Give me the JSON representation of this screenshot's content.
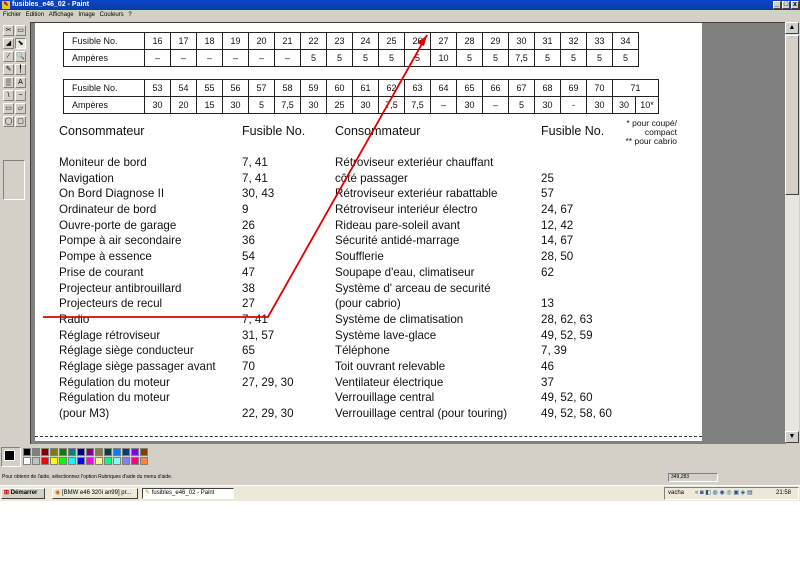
{
  "window": {
    "title": "fusibles_e46_02 - Paint",
    "buttons": [
      "_",
      "□",
      "x"
    ]
  },
  "menu": [
    "Fichier",
    "Edition",
    "Affichage",
    "Image",
    "Couleurs",
    "?"
  ],
  "toolbox": {
    "tools": [
      "free-select",
      "select",
      "eraser",
      "fill",
      "color-picker",
      "magnifier",
      "pencil",
      "brush",
      "airbrush",
      "text",
      "line",
      "curve",
      "rectangle",
      "polygon",
      "ellipse",
      "rounded-rectangle"
    ],
    "glyphs": [
      "✂",
      "▭",
      "◢",
      "⬊",
      "∕",
      "🔍",
      "✎",
      "╿",
      "▒",
      "A",
      "\\",
      "~",
      "▭",
      "▱",
      "◯",
      "▢"
    ]
  },
  "palette": {
    "colors": [
      "#000000",
      "#808080",
      "#800000",
      "#808000",
      "#008000",
      "#008080",
      "#000080",
      "#800080",
      "#808040",
      "#004040",
      "#0080ff",
      "#004080",
      "#8000ff",
      "#804000",
      "#ffffff",
      "#c0c0c0",
      "#ff0000",
      "#ffff00",
      "#00ff00",
      "#00ffff",
      "#0000ff",
      "#ff00ff",
      "#ffff80",
      "#00ff80",
      "#80ffff",
      "#8080ff",
      "#ff0080",
      "#ff8040"
    ]
  },
  "status": {
    "message": "Pour obtenir de l'aide, sélectionnez l'option Rubriques d'aide du menu d'aide.",
    "coords": "349,283"
  },
  "taskbar": {
    "start": "Démarrer",
    "tasks": [
      "[BMW e46 320i an99] pr...",
      "fusibles_e46_02 - Paint"
    ],
    "tray_user": "vacha",
    "clock": "21:58"
  },
  "document": {
    "table1": {
      "row1": [
        "Fusible No.",
        "16",
        "17",
        "18",
        "19",
        "20",
        "21",
        "22",
        "23",
        "24",
        "25",
        "26",
        "27",
        "28",
        "29",
        "30",
        "31",
        "32",
        "33",
        "34"
      ],
      "row2": [
        "Ampères",
        "–",
        "–",
        "–",
        "–",
        "–",
        "–",
        "5",
        "5",
        "5",
        "5",
        "5",
        "10",
        "5",
        "5",
        "7,5",
        "5",
        "5",
        "5",
        "5"
      ]
    },
    "table2": {
      "row1": [
        "Fusible No.",
        "53",
        "54",
        "55",
        "56",
        "57",
        "58",
        "59",
        "60",
        "61",
        "62",
        "63",
        "64",
        "65",
        "66",
        "67",
        "68",
        "69",
        "70",
        "71"
      ],
      "row2": [
        "Ampères",
        "30",
        "20",
        "15",
        "30",
        "5",
        "7,5",
        "30",
        "25",
        "30",
        "7,5",
        "7,5",
        "–",
        "30",
        "–",
        "5",
        "30",
        "-",
        "30",
        "30",
        "10*"
      ]
    },
    "left_header": "Consommateur",
    "left_fuse_header": "Fusible No.",
    "right_header": "Consommateur",
    "right_fuse_header": "Fusible No.",
    "notes": [
      "* pour coupé/",
      "compact",
      "** pour cabrio"
    ],
    "left_items": [
      "Moniteur de bord",
      "Navigation",
      "On Bord Diagnose II",
      "Ordinateur de bord",
      "Ouvre-porte de garage",
      "Pompe à air secondaire",
      "Pompe à essence",
      "Prise de courant",
      "Projecteur antibrouillard",
      "Projecteurs de recul",
      "Radio",
      "Réglage rétroviseur",
      "Réglage siège conducteur",
      "Réglage siège passager avant",
      "Régulation du moteur",
      "Régulation du moteur",
      "(pour M3)"
    ],
    "left_fuses": [
      "7, 41",
      "7, 41",
      "30, 43",
      "9",
      "26",
      "36",
      "54",
      "47",
      "38",
      "27",
      "7, 41",
      "31, 57",
      "65",
      "70",
      "27, 29, 30",
      "",
      "22, 29, 30"
    ],
    "right_items": [
      "Rétroviseur exteriéur chauffant",
      "côté passager",
      "Rétroviseur exteriéur rabattable",
      "Rétroviseur interiéur électro",
      "Rideau pare-soleil avant",
      "Sécurité antidé-marrage",
      "Soufflerie",
      "Soupape d'eau, climatiseur",
      "Système d' arceau de securité",
      "(pour cabrio)",
      "Système de climatisation",
      "Système lave-glace",
      "Téléphone",
      "Toit ouvrant relevable",
      "Ventilateur électrique",
      "Verrouillage central",
      "Verrouillage central (pour touring)"
    ],
    "right_fuses": [
      "",
      "25",
      "57",
      "24, 67",
      "12, 42",
      "14, 67",
      "28, 50",
      "62",
      "",
      "13",
      "28, 62, 63",
      "49, 52, 59",
      "7, 39",
      "46",
      "37",
      "49, 52, 60",
      "49, 52, 58, 60"
    ],
    "annotation_color": "#e00000"
  }
}
